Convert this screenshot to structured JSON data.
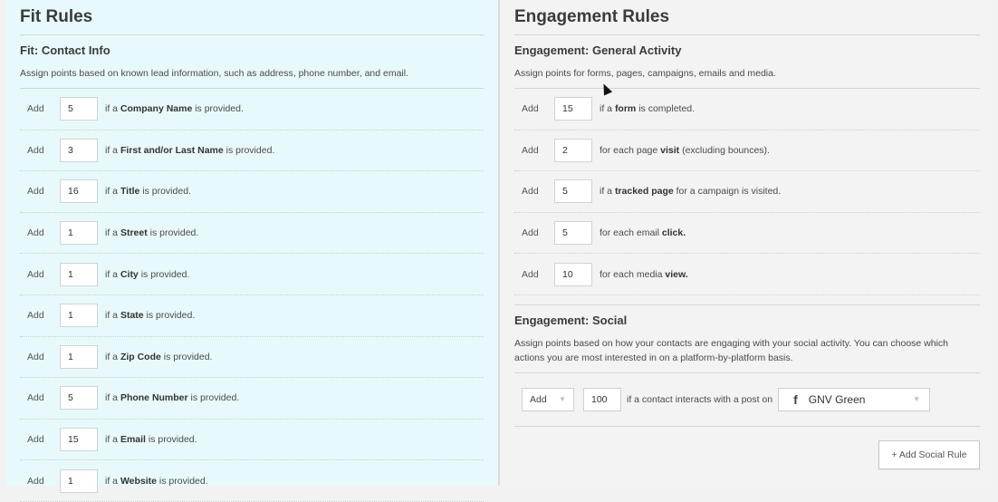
{
  "fit": {
    "title": "Fit Rules",
    "section_title": "Fit: Contact Info",
    "section_desc": "Assign points based on known lead information, such as address, phone number, and email.",
    "rules": [
      {
        "add": "Add",
        "points": "5",
        "pre": "if a ",
        "field": "Company Name",
        "post": " is provided."
      },
      {
        "add": "Add",
        "points": "3",
        "pre": "if a ",
        "field": "First and/or Last Name",
        "post": " is provided."
      },
      {
        "add": "Add",
        "points": "16",
        "pre": "if a ",
        "field": "Title",
        "post": " is provided."
      },
      {
        "add": "Add",
        "points": "1",
        "pre": "if a ",
        "field": "Street",
        "post": " is provided."
      },
      {
        "add": "Add",
        "points": "1",
        "pre": "if a ",
        "field": "City",
        "post": " is provided."
      },
      {
        "add": "Add",
        "points": "1",
        "pre": "if a ",
        "field": "State",
        "post": " is provided."
      },
      {
        "add": "Add",
        "points": "1",
        "pre": "if a ",
        "field": "Zip Code",
        "post": " is provided."
      },
      {
        "add": "Add",
        "points": "5",
        "pre": "if a ",
        "field": "Phone Number",
        "post": " is provided."
      },
      {
        "add": "Add",
        "points": "15",
        "pre": "if a ",
        "field": "Email",
        "post": " is provided."
      },
      {
        "add": "Add",
        "points": "1",
        "pre": "if a ",
        "field": "Website",
        "post": " is provided."
      }
    ]
  },
  "engagement": {
    "title": "Engagement Rules",
    "general_title": "Engagement: General Activity",
    "general_desc": "Assign points for forms, pages, campaigns, emails and media.",
    "rules": [
      {
        "add": "Add",
        "points": "15",
        "pre": "if a ",
        "field": "form",
        "post": " is completed."
      },
      {
        "add": "Add",
        "points": "2",
        "pre": "for each page ",
        "field": "visit",
        "post": " (excluding bounces)."
      },
      {
        "add": "Add",
        "points": "5",
        "pre": "if a ",
        "field": "tracked page",
        "post": " for a campaign is visited."
      },
      {
        "add": "Add",
        "points": "5",
        "pre": "for each email ",
        "field": "click.",
        "post": ""
      },
      {
        "add": "Add",
        "points": "10",
        "pre": "for each media ",
        "field": "view.",
        "post": ""
      }
    ],
    "social_title": "Engagement: Social",
    "social_desc": "Assign points based on how your contacts are engaging with your social activity. You can choose which actions you are most interested in on a platform-by-platform basis.",
    "social_rule": {
      "add_select": "Add",
      "points": "100",
      "text": "if a contact interacts with a post on",
      "platform_icon": "facebook-icon",
      "platform": "GNV Green"
    },
    "add_social_button": "+ Add Social Rule"
  }
}
